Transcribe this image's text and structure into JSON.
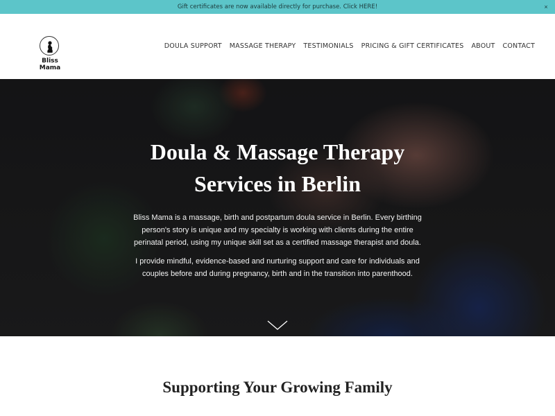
{
  "announcement": {
    "text": "Gift certificates are now available directly for purchase. Click HERE!",
    "close_label": "×"
  },
  "header": {
    "logo_text": "Bliss Mama",
    "nav": [
      "DOULA SUPPORT",
      "MASSAGE THERAPY",
      "TESTIMONIALS",
      "PRICING & GIFT CERTIFICATES",
      "ABOUT",
      "CONTACT"
    ]
  },
  "hero": {
    "title_line1": "Doula & Massage Therapy",
    "title_line2": "Services in Berlin",
    "paragraph1": "Bliss Mama is a massage, birth and postpartum doula service in Berlin. Every birthing person's story is unique and my specialty is working with clients during the entire perinatal period, using my unique skill set as a certified massage therapist and doula.",
    "paragraph2": "I provide mindful, evidence-based and nurturing support and care for individuals and couples before and during pregnancy, birth and in the transition into parenthood."
  },
  "section": {
    "title": "Supporting Your Growing Family"
  },
  "colors": {
    "announcement_bg": "#5cc5c9",
    "hero_text": "#ffffff"
  },
  "icons": {
    "logo": "pregnant-silhouette-icon",
    "close": "close-icon",
    "scroll": "chevron-down-icon"
  }
}
